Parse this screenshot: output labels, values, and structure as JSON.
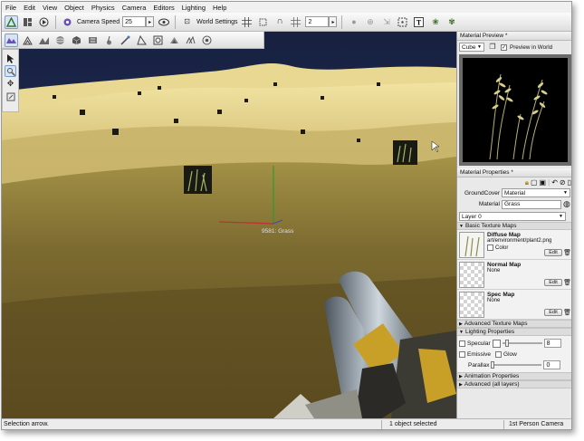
{
  "menu": [
    "File",
    "Edit",
    "View",
    "Object",
    "Physics",
    "Camera",
    "Editors",
    "Lighting",
    "Help"
  ],
  "toolbar": {
    "camera_speed_label": "Camera Speed",
    "camera_speed_value": "25",
    "world_settings_label": "World Settings",
    "grid_value": "2"
  },
  "viewport": {
    "object_label": "9581: Grass"
  },
  "material_preview": {
    "title": "Material Preview *",
    "shape": "Cube",
    "preview_in_world": "Preview in World"
  },
  "material_properties": {
    "title": "Material Properties *",
    "groundcover_label": "GroundCover",
    "groundcover_value": "Material",
    "material_label": "Material",
    "material_value": "Grass",
    "layer": "Layer 0",
    "basic_maps_section": "Basic Texture Maps",
    "diffuse": {
      "name": "Diffuse Map",
      "path": "art/environment/plant2.png",
      "color_label": "Color",
      "edit": "Edit"
    },
    "normal": {
      "name": "Normal Map",
      "path": "None",
      "edit": "Edit"
    },
    "spec": {
      "name": "Spec Map",
      "path": "None",
      "edit": "Edit"
    },
    "advanced_maps_section": "Advanced Texture Maps",
    "lighting_section": "Lighting Properties",
    "specular_label": "Specular",
    "specular_value": "8",
    "emissive_label": "Emissive",
    "glow_label": "Glow",
    "parallax_label": "Parallax",
    "parallax_value": "0",
    "animation_section": "Animation Properties",
    "advanced_all_section": "Advanced (all layers)"
  },
  "status": {
    "tool": "Selection arrow.",
    "selection": "1 object selected",
    "camera": "1st Person Camera"
  }
}
